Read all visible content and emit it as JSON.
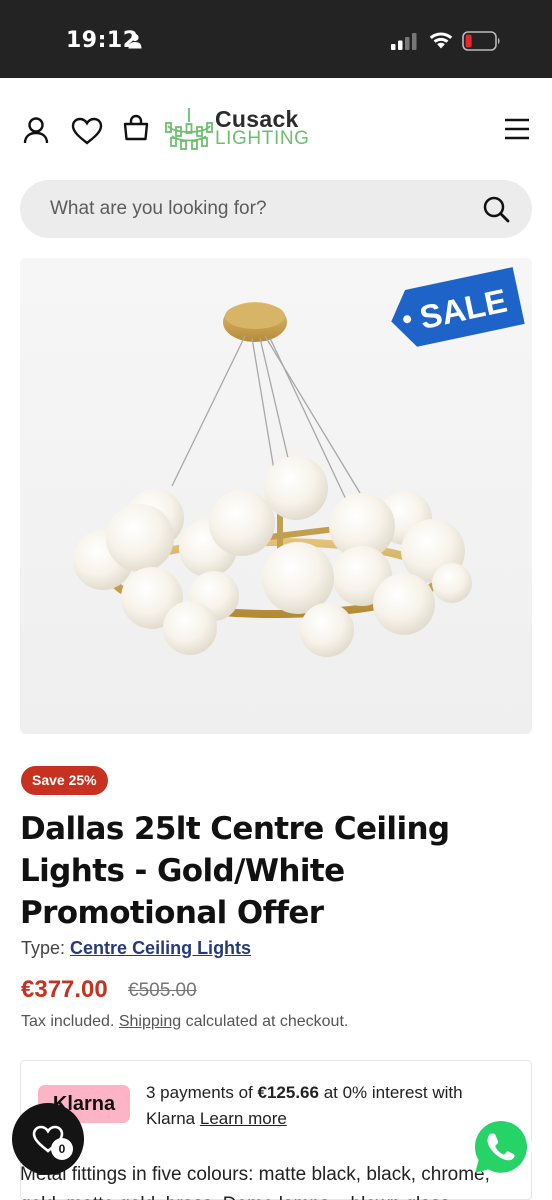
{
  "status_bar": {
    "time": "19:12"
  },
  "header": {
    "brand_line1": "Cusack",
    "brand_line2": "LIGHTING",
    "icons": [
      "account-icon",
      "wishlist-icon",
      "cart-icon",
      "menu-icon"
    ]
  },
  "search": {
    "placeholder": "What are you looking for?"
  },
  "product": {
    "image_badge": "SALE",
    "save_badge": "Save 25%",
    "title": "Dallas 25lt Centre Ceiling Lights - Gold/White Promotional Offer",
    "type_label": "Type:",
    "type_value": "Centre Ceiling Lights",
    "price": "€377.00",
    "compare_price": "€505.00",
    "tax_prefix": "Tax included.",
    "tax_link": "Shipping",
    "tax_suffix": "calculated at checkout."
  },
  "klarna": {
    "logo": "Klarna",
    "text_prefix": "3 payments of",
    "amount": "€125.66",
    "text_suffix": "at 0% interest with Klarna",
    "link": "Learn more"
  },
  "description": {
    "line1": "Metal fittings in five colours: matte black, black, chrome,",
    "line2": "gold, matte gold, brass. Dome lamps – blown glass"
  },
  "floating": {
    "wishlist_count": "0"
  },
  "colors": {
    "status_bar": "#232323",
    "accent_red": "#c7311f",
    "brand_green": "#6cc06d",
    "sale_blue": "#1e63c8",
    "klarna_pink": "#ffb3c7",
    "link_blue": "#243a7a",
    "whatsapp_green": "#25d366"
  }
}
